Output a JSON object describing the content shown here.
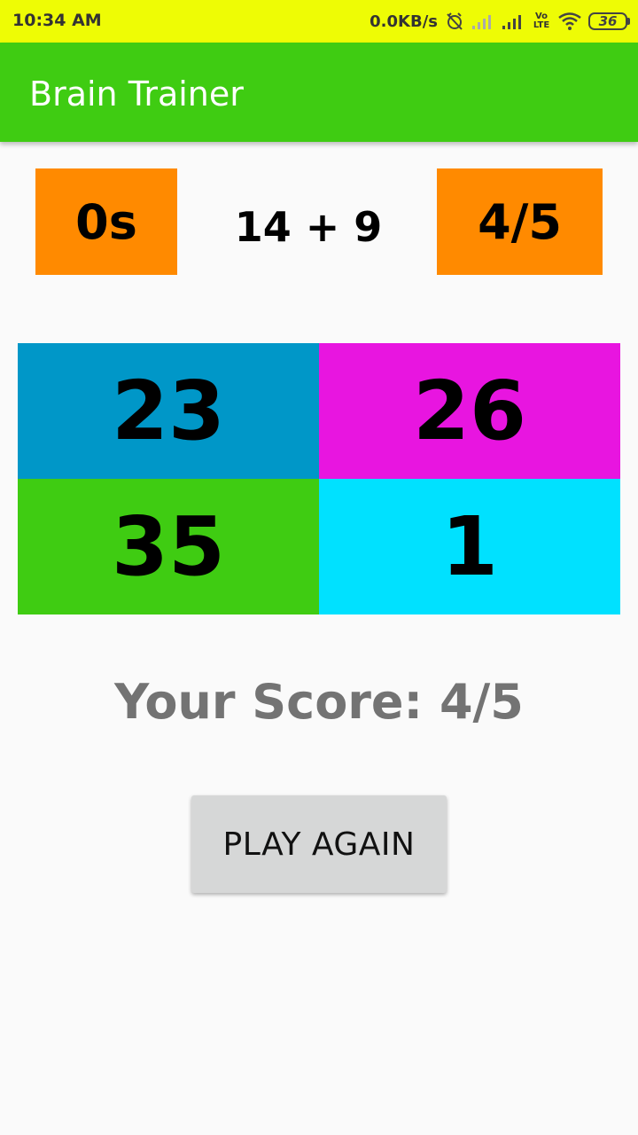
{
  "status_bar": {
    "time": "10:34 AM",
    "network_speed": "0.0KB/s",
    "volte_label": "Vo LTE",
    "battery": "36",
    "icons": [
      "alarm-off-icon",
      "signal-icon",
      "signal-icon",
      "volte-icon",
      "wifi-icon",
      "battery-icon"
    ]
  },
  "app_bar": {
    "title": "Brain Trainer",
    "color": "#3fcc12"
  },
  "game": {
    "timer": "0s",
    "question": "14 + 9",
    "score": "4/5",
    "answers": [
      {
        "value": "23",
        "color": "#0097c8"
      },
      {
        "value": "26",
        "color": "#e815e0"
      },
      {
        "value": "35",
        "color": "#3fcc12"
      },
      {
        "value": "1",
        "color": "#00e1ff"
      }
    ],
    "result_text": "Your Score: 4/5",
    "play_again_label": "PLAY AGAIN"
  },
  "colors": {
    "status_bar": "#eefc05",
    "box_orange": "#ff8a00",
    "button_gray": "#d6d7d7"
  }
}
